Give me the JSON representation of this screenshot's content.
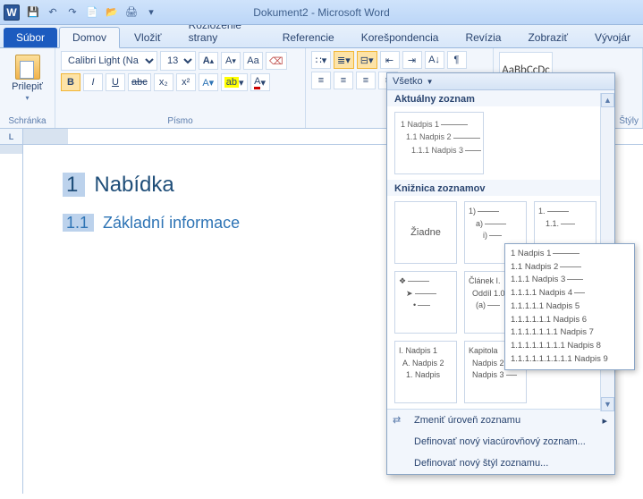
{
  "title": "Dokument2 - Microsoft Word",
  "qat": {
    "save": "💾",
    "undo": "↶",
    "redo": "↷",
    "new": "📄",
    "open": "📂",
    "print": "🖨"
  },
  "tabs": {
    "file": "Súbor",
    "home": "Domov",
    "insert": "Vložiť",
    "layout": "Rozloženie strany",
    "references": "Referencie",
    "mailings": "Korešpondencia",
    "review": "Revízia",
    "view": "Zobraziť",
    "developer": "Vývojár"
  },
  "clipboard": {
    "paste": "Prilepiť",
    "group": "Schránka"
  },
  "font": {
    "name": "Calibri Light (Na",
    "size": "13",
    "group": "Písmo",
    "bold": "B",
    "italic": "I",
    "underline": "U",
    "strike": "abc",
    "sub": "x₂",
    "sup": "x²",
    "clear": "A",
    "case": "Aa",
    "grow": "A",
    "shrink": "A"
  },
  "styles": {
    "preview": "AaBbCcDc",
    "group": "Štýly"
  },
  "doc": {
    "h1_num": "1",
    "h1": "Nabídka",
    "h2_num": "1.1",
    "h2": "Základní informace"
  },
  "dropdown": {
    "all": "Všetko",
    "current": "Aktuálny zoznam",
    "cur_l1": "1 Nadpis 1",
    "cur_l2": "1.1 Nadpis 2",
    "cur_l3": "1.1.1 Nadpis 3",
    "library": "Knižnica zoznamov",
    "none": "Žiadne",
    "opt2_l1": "1)",
    "opt2_l2": "a)",
    "opt2_l3": "i)",
    "opt3_l1": "1.",
    "opt3_l2": "1.1.",
    "opt3_l3": "",
    "opt4_l1": "❖",
    "opt4_l2": "➤",
    "opt4_l3": "•",
    "opt5_l1": "Článek I.",
    "opt5_l2": "Oddíl 1.0",
    "opt5_l3": "(a)",
    "opt7_l1": "I. Nadpis 1",
    "opt7_l2": "A. Nadpis 2",
    "opt7_l3": "1. Nadpis",
    "opt8_l1": "Kapitola",
    "opt8_l2": "Nadpis 2",
    "opt8_l3": "Nadpis 3",
    "menu_level": "Zmeniť úroveň zoznamu",
    "menu_define_list": "Definovať nový viacúrovňový zoznam...",
    "menu_define_style": "Definovať nový štýl zoznamu..."
  },
  "tooltip": {
    "l1": "1 Nadpis 1",
    "l2": "1.1 Nadpis 2",
    "l3": "1.1.1 Nadpis 3",
    "l4": "1.1.1.1 Nadpis 4",
    "l5": "1.1.1.1.1 Nadpis 5",
    "l6": "1.1.1.1.1.1 Nadpis 6",
    "l7": "1.1.1.1.1.1.1 Nadpis 7",
    "l8": "1.1.1.1.1.1.1.1 Nadpis 8",
    "l9": "1.1.1.1.1.1.1.1.1 Nadpis 9"
  },
  "ruler_corner": "L"
}
